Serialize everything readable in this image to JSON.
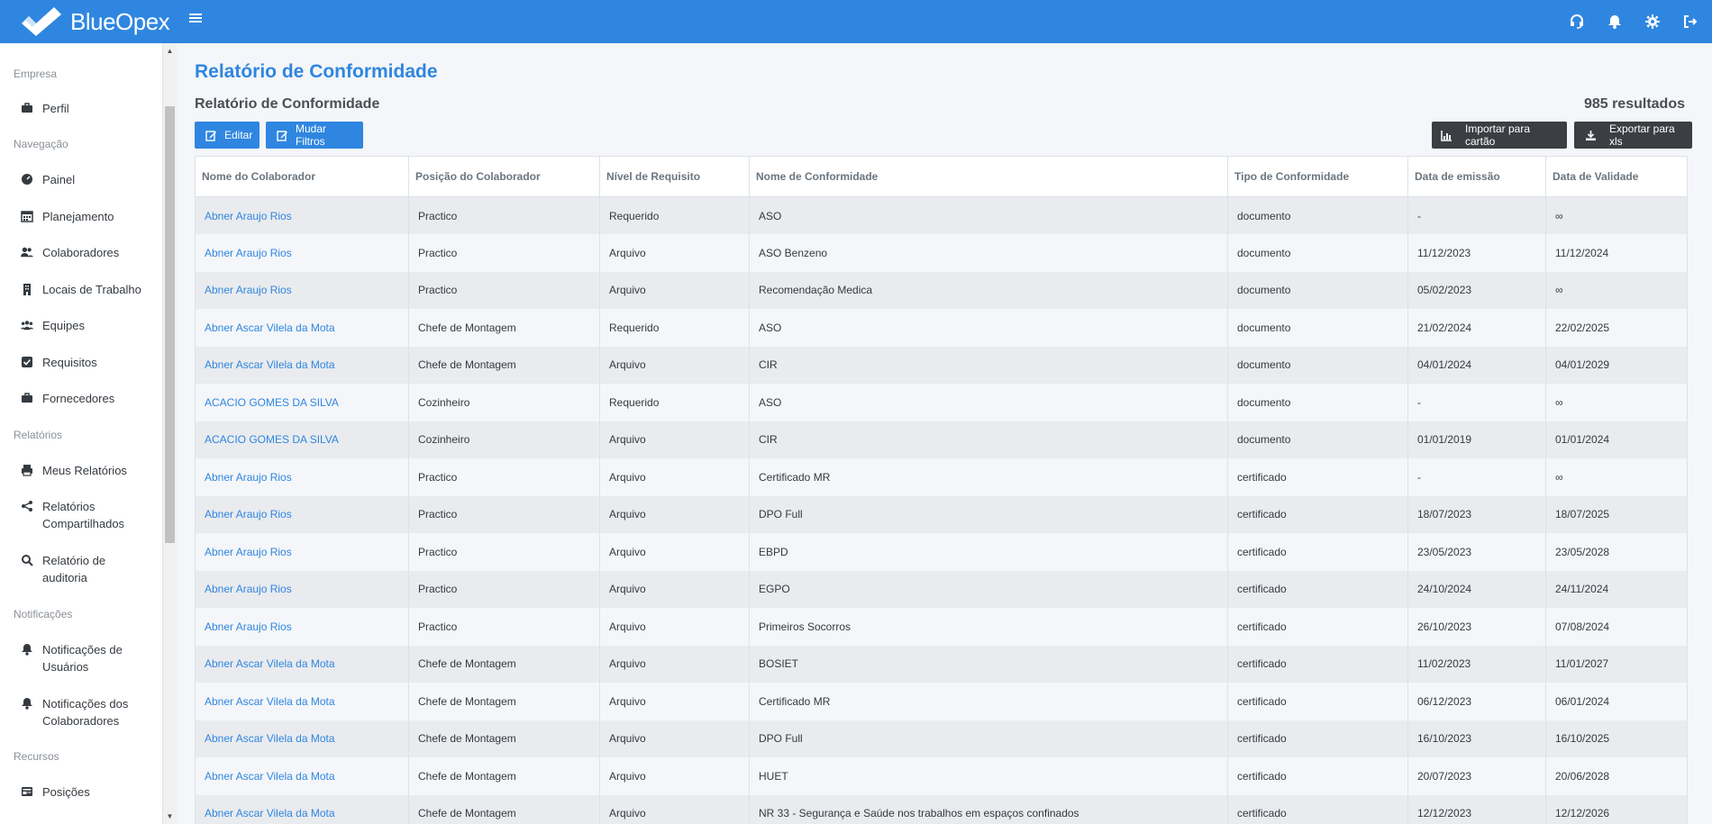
{
  "app": {
    "brand": "BlueOpex"
  },
  "colors": {
    "primary": "#2f86e0",
    "dark_button": "#3b3f44"
  },
  "topbar": {
    "icons": [
      "headset-icon",
      "bell-icon",
      "gear-icon",
      "logout-icon"
    ]
  },
  "sidebar": {
    "sections": [
      {
        "header": "Empresa",
        "items": [
          {
            "label": "Perfil",
            "icon": "briefcase-icon"
          }
        ]
      },
      {
        "header": "Navegação",
        "items": [
          {
            "label": "Painel",
            "icon": "dashboard-icon"
          },
          {
            "label": "Planejamento",
            "icon": "calendar-icon"
          },
          {
            "label": "Colaboradores",
            "icon": "users-icon"
          },
          {
            "label": "Locais de Trabalho",
            "icon": "building-icon"
          },
          {
            "label": "Equipes",
            "icon": "team-icon"
          },
          {
            "label": "Requisitos",
            "icon": "checkbox-icon"
          },
          {
            "label": "Fornecedores",
            "icon": "briefcase-icon"
          }
        ]
      },
      {
        "header": "Relatórios",
        "items": [
          {
            "label": "Meus Relatórios",
            "icon": "printer-icon"
          },
          {
            "label": "Relatórios Compartilhados",
            "icon": "share-icon"
          },
          {
            "label": "Relatório de auditoria",
            "icon": "search-doc-icon"
          }
        ]
      },
      {
        "header": "Notificações",
        "items": [
          {
            "label": "Notificações de Usuários",
            "icon": "bell-icon"
          },
          {
            "label": "Notificações dos Colaboradores",
            "icon": "bell-icon"
          }
        ]
      },
      {
        "header": "Recursos",
        "items": [
          {
            "label": "Posições",
            "icon": "id-card-icon"
          }
        ]
      }
    ]
  },
  "main": {
    "page_title": "Relatório de Conformidade",
    "card_title": "Relatório de Conformidade",
    "result_count": "985 resultados",
    "buttons": {
      "edit": "Editar",
      "change_filters": "Mudar Filtros",
      "import_card": "Importar para cartão",
      "export_xls": "Exportar para xls"
    },
    "table": {
      "columns": [
        "Nome do Colaborador",
        "Posição do Colaborador",
        "Nível de Requisito",
        "Nome de Conformidade",
        "Tipo de Conformidade",
        "Data de emissão",
        "Data de Validade"
      ],
      "rows": [
        [
          "Abner Araujo Rios",
          "Practico",
          "Requerido",
          "ASO",
          "documento",
          "-",
          "∞"
        ],
        [
          "Abner Araujo Rios",
          "Practico",
          "Arquivo",
          "ASO Benzeno",
          "documento",
          "11/12/2023",
          "11/12/2024"
        ],
        [
          "Abner Araujo Rios",
          "Practico",
          "Arquivo",
          "Recomendação Medica",
          "documento",
          "05/02/2023",
          "∞"
        ],
        [
          "Abner Ascar Vilela da Mota",
          "Chefe de Montagem",
          "Requerido",
          "ASO",
          "documento",
          "21/02/2024",
          "22/02/2025"
        ],
        [
          "Abner Ascar Vilela da Mota",
          "Chefe de Montagem",
          "Arquivo",
          "CIR",
          "documento",
          "04/01/2024",
          "04/01/2029"
        ],
        [
          "ACACIO GOMES DA SILVA",
          "Cozinheiro",
          "Requerido",
          "ASO",
          "documento",
          "-",
          "∞"
        ],
        [
          "ACACIO GOMES DA SILVA",
          "Cozinheiro",
          "Arquivo",
          "CIR",
          "documento",
          "01/01/2019",
          "01/01/2024"
        ],
        [
          "Abner Araujo Rios",
          "Practico",
          "Arquivo",
          "Certificado MR",
          "certificado",
          "-",
          "∞"
        ],
        [
          "Abner Araujo Rios",
          "Practico",
          "Arquivo",
          "DPO Full",
          "certificado",
          "18/07/2023",
          "18/07/2025"
        ],
        [
          "Abner Araujo Rios",
          "Practico",
          "Arquivo",
          "EBPD",
          "certificado",
          "23/05/2023",
          "23/05/2028"
        ],
        [
          "Abner Araujo Rios",
          "Practico",
          "Arquivo",
          "EGPO",
          "certificado",
          "24/10/2024",
          "24/11/2024"
        ],
        [
          "Abner Araujo Rios",
          "Practico",
          "Arquivo",
          "Primeiros Socorros",
          "certificado",
          "26/10/2023",
          "07/08/2024"
        ],
        [
          "Abner Ascar Vilela da Mota",
          "Chefe de Montagem",
          "Arquivo",
          "BOSIET",
          "certificado",
          "11/02/2023",
          "11/01/2027"
        ],
        [
          "Abner Ascar Vilela da Mota",
          "Chefe de Montagem",
          "Arquivo",
          "Certificado MR",
          "certificado",
          "06/12/2023",
          "06/01/2024"
        ],
        [
          "Abner Ascar Vilela da Mota",
          "Chefe de Montagem",
          "Arquivo",
          "DPO Full",
          "certificado",
          "16/10/2023",
          "16/10/2025"
        ],
        [
          "Abner Ascar Vilela da Mota",
          "Chefe de Montagem",
          "Arquivo",
          "HUET",
          "certificado",
          "20/07/2023",
          "20/06/2028"
        ],
        [
          "Abner Ascar Vilela da Mota",
          "Chefe de Montagem",
          "Arquivo",
          "NR 33 - Segurança e Saúde nos trabalhos em espaços confinados",
          "certificado",
          "12/12/2023",
          "12/12/2026"
        ]
      ]
    }
  }
}
